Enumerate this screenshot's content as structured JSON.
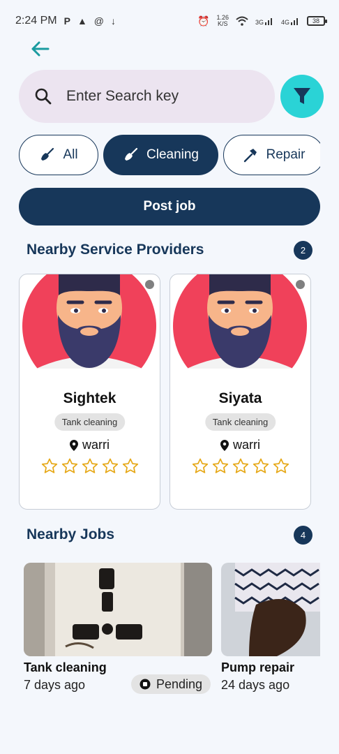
{
  "status_bar": {
    "time": "2:24 PM",
    "speed_value": "1.26",
    "speed_unit": "K/S",
    "net1": "3G",
    "net2": "4G",
    "battery": "38"
  },
  "search": {
    "placeholder": "Enter Search key"
  },
  "categories": [
    {
      "label": "All",
      "icon": "broom-icon",
      "active": false
    },
    {
      "label": "Cleaning",
      "icon": "broom-icon",
      "active": true
    },
    {
      "label": "Repair",
      "icon": "hammer-icon",
      "active": false
    }
  ],
  "post_job": {
    "label": "Post job"
  },
  "providers_section": {
    "title": "Nearby Service Providers",
    "count": "2"
  },
  "providers": [
    {
      "name": "Sightek",
      "service": "Tank cleaning",
      "location": "warri",
      "rating": 0
    },
    {
      "name": "Siyata",
      "service": "Tank cleaning",
      "location": "warri",
      "rating": 0
    }
  ],
  "jobs_section": {
    "title": "Nearby Jobs",
    "count": "4"
  },
  "jobs": [
    {
      "title": "Tank cleaning",
      "time": "7 days ago",
      "status": "Pending"
    },
    {
      "title": "Pump repair",
      "time": "24 days ago"
    }
  ],
  "colors": {
    "primary": "#17375a",
    "accent": "#2ad3d6",
    "back_arrow": "#1a9ba0",
    "star": "#e6a817"
  }
}
